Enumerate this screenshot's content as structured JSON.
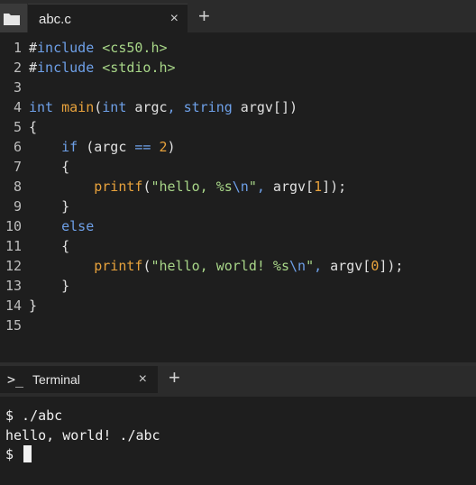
{
  "editor": {
    "tab": {
      "filename": "abc.c",
      "close_glyph": "×"
    },
    "new_tab_glyph": "+",
    "line_numbers": [
      "1",
      "2",
      "3",
      "4",
      "5",
      "6",
      "7",
      "8",
      "9",
      "10",
      "11",
      "12",
      "13",
      "14",
      "15"
    ],
    "code": {
      "l1": "#include <cs50.h>",
      "l2": "#include <stdio.h>",
      "l4": "int main(int argc, string argv[])",
      "l5": "{",
      "l6": "    if (argc == 2)",
      "l7": "    {",
      "l8": "        printf(\"hello, %s\\n\", argv[1]);",
      "l9": "    }",
      "l10": "    else",
      "l11": "    {",
      "l12": "        printf(\"hello, world! %s\\n\", argv[0]);",
      "l13": "    }",
      "l14": "}"
    }
  },
  "terminal": {
    "tab_label": "Terminal",
    "tab_icon": ">_",
    "close_glyph": "×",
    "new_tab_glyph": "+",
    "lines": [
      "$ ./abc",
      "hello, world! ./abc",
      "$ "
    ]
  },
  "colors": {
    "keyword": "#6ea0e8",
    "function": "#e8a23c",
    "string": "#a8d688",
    "background": "#1e1e1e"
  }
}
